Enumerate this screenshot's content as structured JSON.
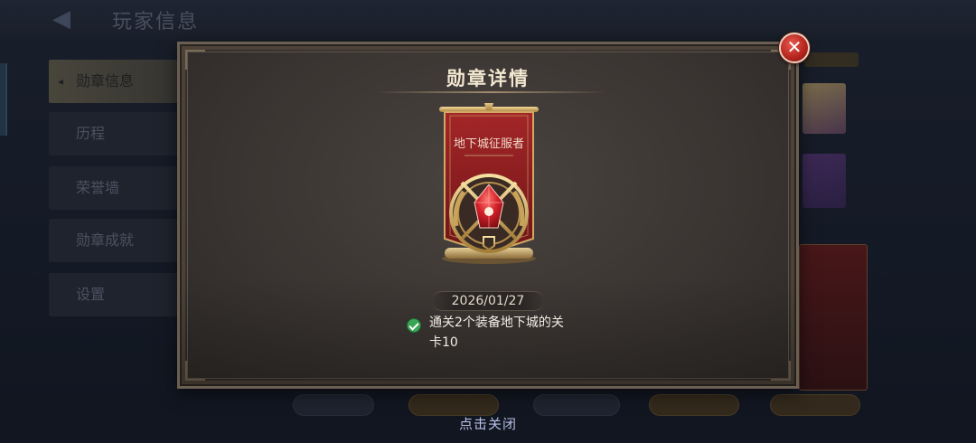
{
  "background": {
    "title": "玩家信息",
    "tabs": [
      "勋章信息",
      "历程",
      "荣誉墙",
      "勋章成就",
      "设置"
    ]
  },
  "modal": {
    "title": "勋章详情",
    "medal": {
      "name": "地下城征服者",
      "date": "2026/01/27"
    },
    "requirement": {
      "text": "通关2个装备地下城的关卡10",
      "completed": true
    },
    "close_icon": "close-icon"
  },
  "footer": {
    "tap_to_close": "点击关闭"
  },
  "colors": {
    "banner_red": "#8e1d1f",
    "gold": "#d9b56a",
    "check_green": "#3aa554",
    "close_red": "#c0302a"
  }
}
